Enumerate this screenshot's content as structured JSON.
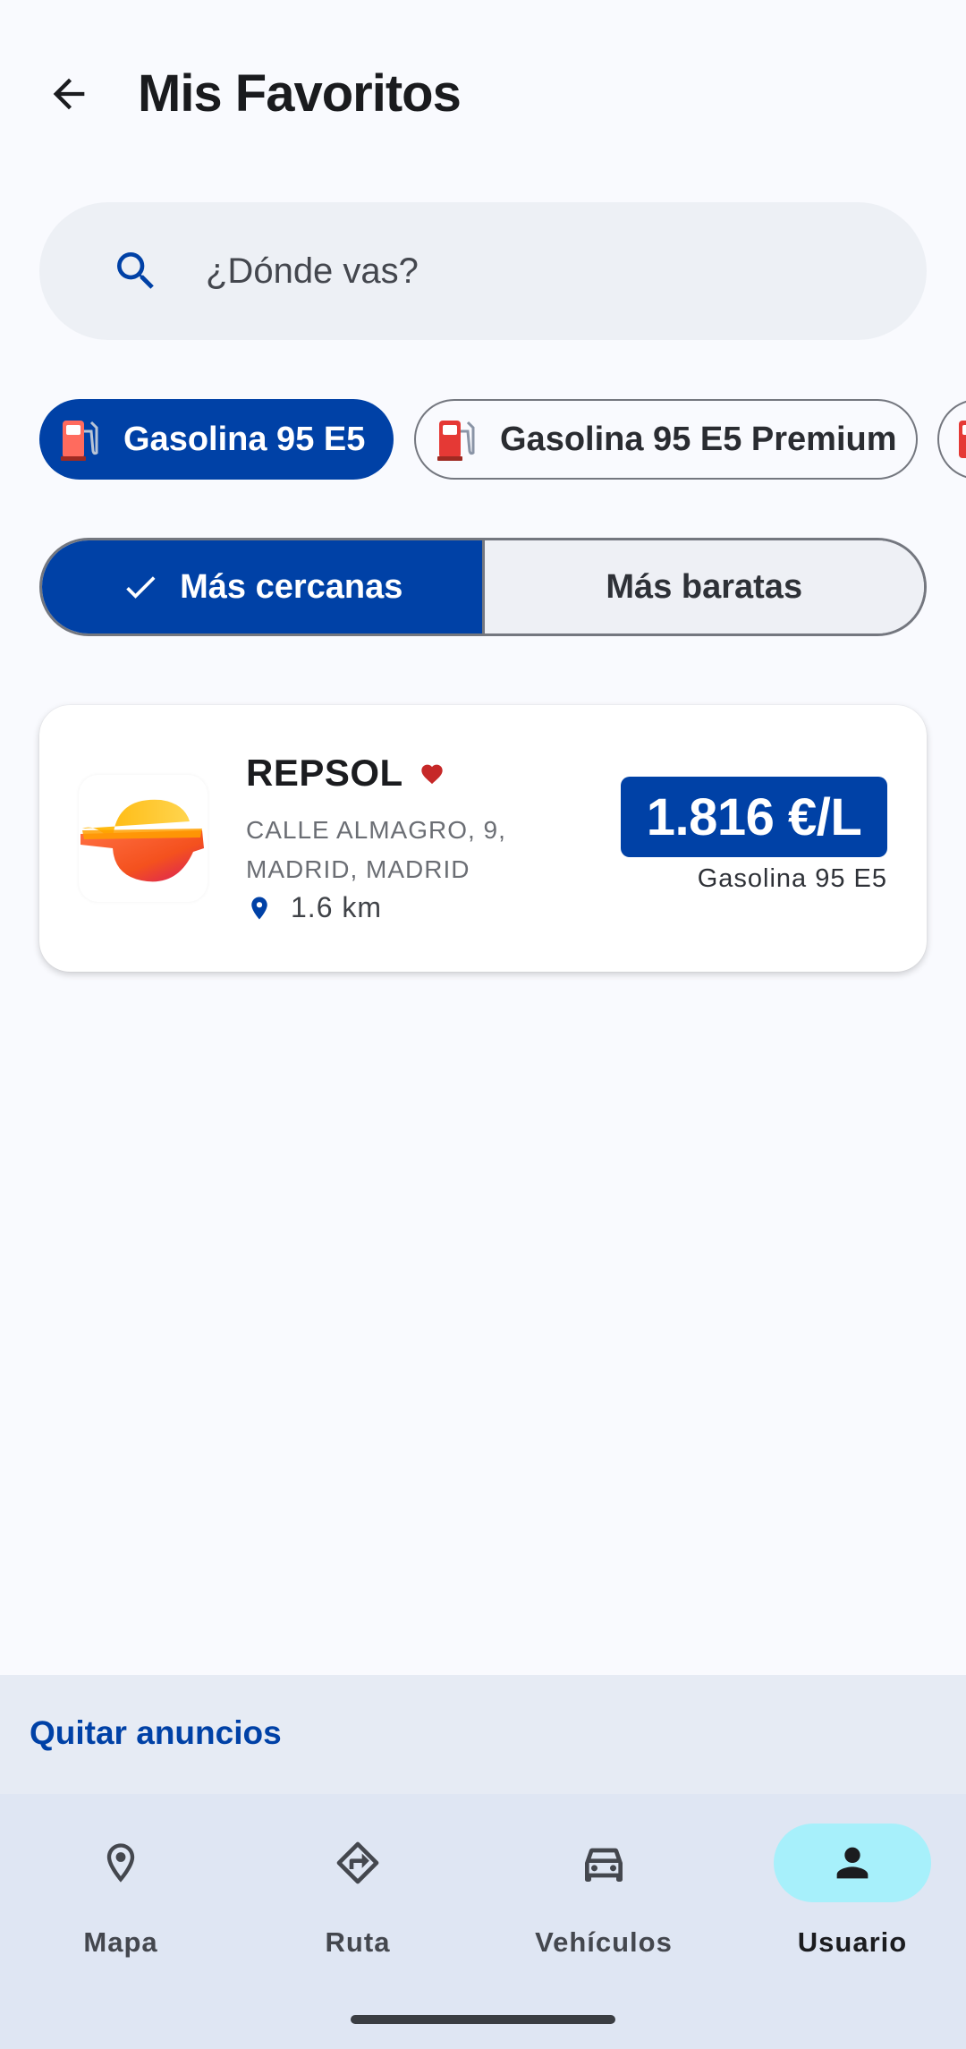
{
  "header": {
    "back_icon": "arrow-back-icon",
    "title": "Mis Favoritos"
  },
  "search": {
    "icon": "search-icon",
    "placeholder": "¿Dónde vas?"
  },
  "fuel_chips": [
    {
      "label": "Gasolina 95 E5",
      "selected": true,
      "icon": "fuel-pump-icon"
    },
    {
      "label": "Gasolina 95 E5 Premium",
      "selected": false,
      "icon": "fuel-pump-icon"
    },
    {
      "label": "",
      "selected": false,
      "icon": "fuel-pump-icon"
    }
  ],
  "sort": {
    "options": [
      {
        "label": "Más cercanas",
        "selected": true
      },
      {
        "label": "Más baratas",
        "selected": false
      }
    ]
  },
  "stations": [
    {
      "brand": "REPSOL",
      "favorite": true,
      "address": "CALLE ALMAGRO, 9, MADRID, MADRID",
      "distance": "1.6 km",
      "price": "1.816 €/L",
      "fuel": "Gasolina 95 E5"
    }
  ],
  "ads": {
    "remove_label": "Quitar anuncios"
  },
  "bottom_nav": [
    {
      "label": "Mapa",
      "icon": "map-pin-icon",
      "active": false
    },
    {
      "label": "Ruta",
      "icon": "route-icon",
      "active": false
    },
    {
      "label": "Vehículos",
      "icon": "car-icon",
      "active": false
    },
    {
      "label": "Usuario",
      "icon": "user-icon",
      "active": true
    }
  ],
  "colors": {
    "primary": "#0041a6",
    "background": "#f9fafe",
    "favorite": "#c62828",
    "active_nav_pill": "#a7f0fb"
  }
}
